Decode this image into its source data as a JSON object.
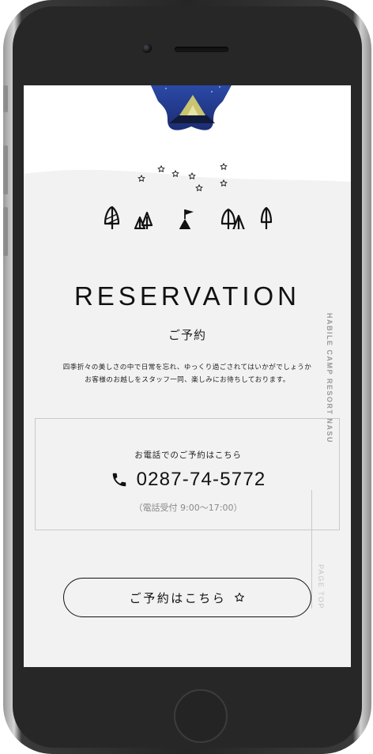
{
  "device": {
    "model": "smartphone",
    "frame_color": "#262626",
    "screen_background": "#f2f2f2"
  },
  "hero": {
    "image_alt_icon": "tent-under-starry-sky-photo",
    "sky_colors": [
      "#1c2d73",
      "#2b4aa8"
    ],
    "tent_color": "#c9c472"
  },
  "icons": [
    "star-icon",
    "tree-icon",
    "tree-icon",
    "circus-tent-icon",
    "tree-icon",
    "tree-icon"
  ],
  "section": {
    "title": "RESERVATION",
    "subtitle": "ご予約",
    "description_lines": [
      "四季折々の美しさの中で日常を忘れ、ゆっくり過ごされてはいかがでしょうか",
      "お客様のお越しをスタッフ一同、楽しみにお待ちしております。"
    ]
  },
  "phone_box": {
    "caption": "お電話でのご予約はこちら",
    "icon": "phone-icon",
    "number": "0287-74-5772",
    "hours": "（電話受付 9:00〜17:00）"
  },
  "cta": {
    "label": "ご予約はこちら",
    "icon": "star-icon"
  },
  "side": {
    "vertical_text": "HABILE CAMP RESORT NASU",
    "page_top": "PAGE TOP"
  },
  "colors": {
    "text": "#111111",
    "muted": "#8a8a8a",
    "border": "#c9c9c9"
  }
}
